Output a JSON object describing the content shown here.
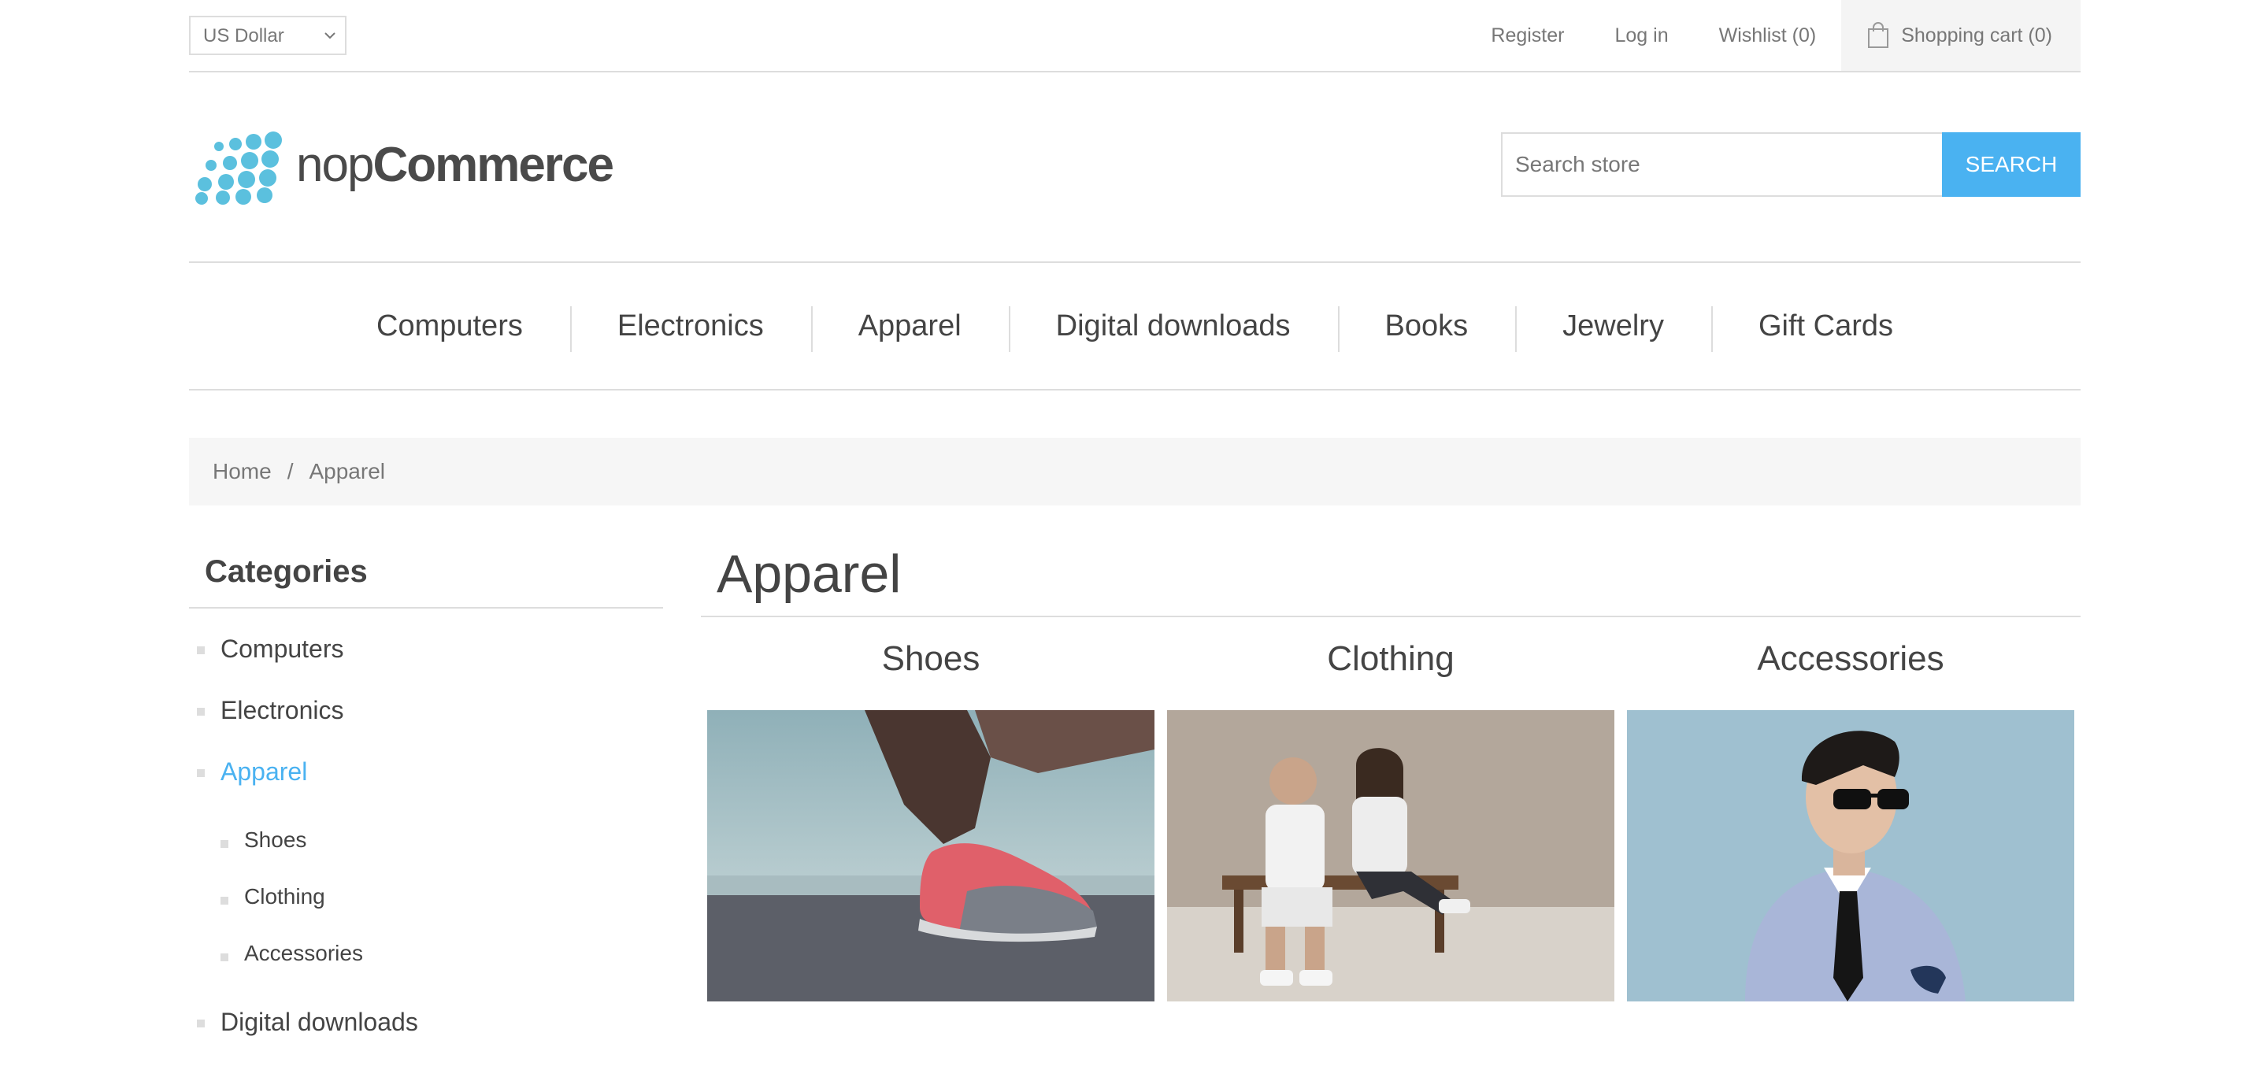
{
  "header": {
    "currency": "US Dollar",
    "links": [
      "Register",
      "Log in",
      "Wishlist (0)"
    ],
    "cart": "Shopping cart (0)"
  },
  "logo": {
    "text_light": "nop",
    "text_bold": "Commerce"
  },
  "search": {
    "placeholder": "Search store",
    "button": "SEARCH"
  },
  "menu": [
    "Computers",
    "Electronics",
    "Apparel",
    "Digital downloads",
    "Books",
    "Jewelry",
    "Gift Cards"
  ],
  "breadcrumb": {
    "home": "Home",
    "separator": "/",
    "current": "Apparel"
  },
  "sidebar": {
    "title": "Categories",
    "categories": [
      "Computers",
      "Electronics",
      "Apparel"
    ],
    "subcategories": [
      "Shoes",
      "Clothing",
      "Accessories"
    ],
    "next_category": "Digital downloads"
  },
  "page": {
    "title": "Apparel",
    "items": [
      {
        "title": "Shoes"
      },
      {
        "title": "Clothing"
      },
      {
        "title": "Accessories"
      }
    ]
  },
  "colors": {
    "accent": "#4ab2f1",
    "text": "#444444",
    "muted": "#777777",
    "border": "#dddddd"
  }
}
